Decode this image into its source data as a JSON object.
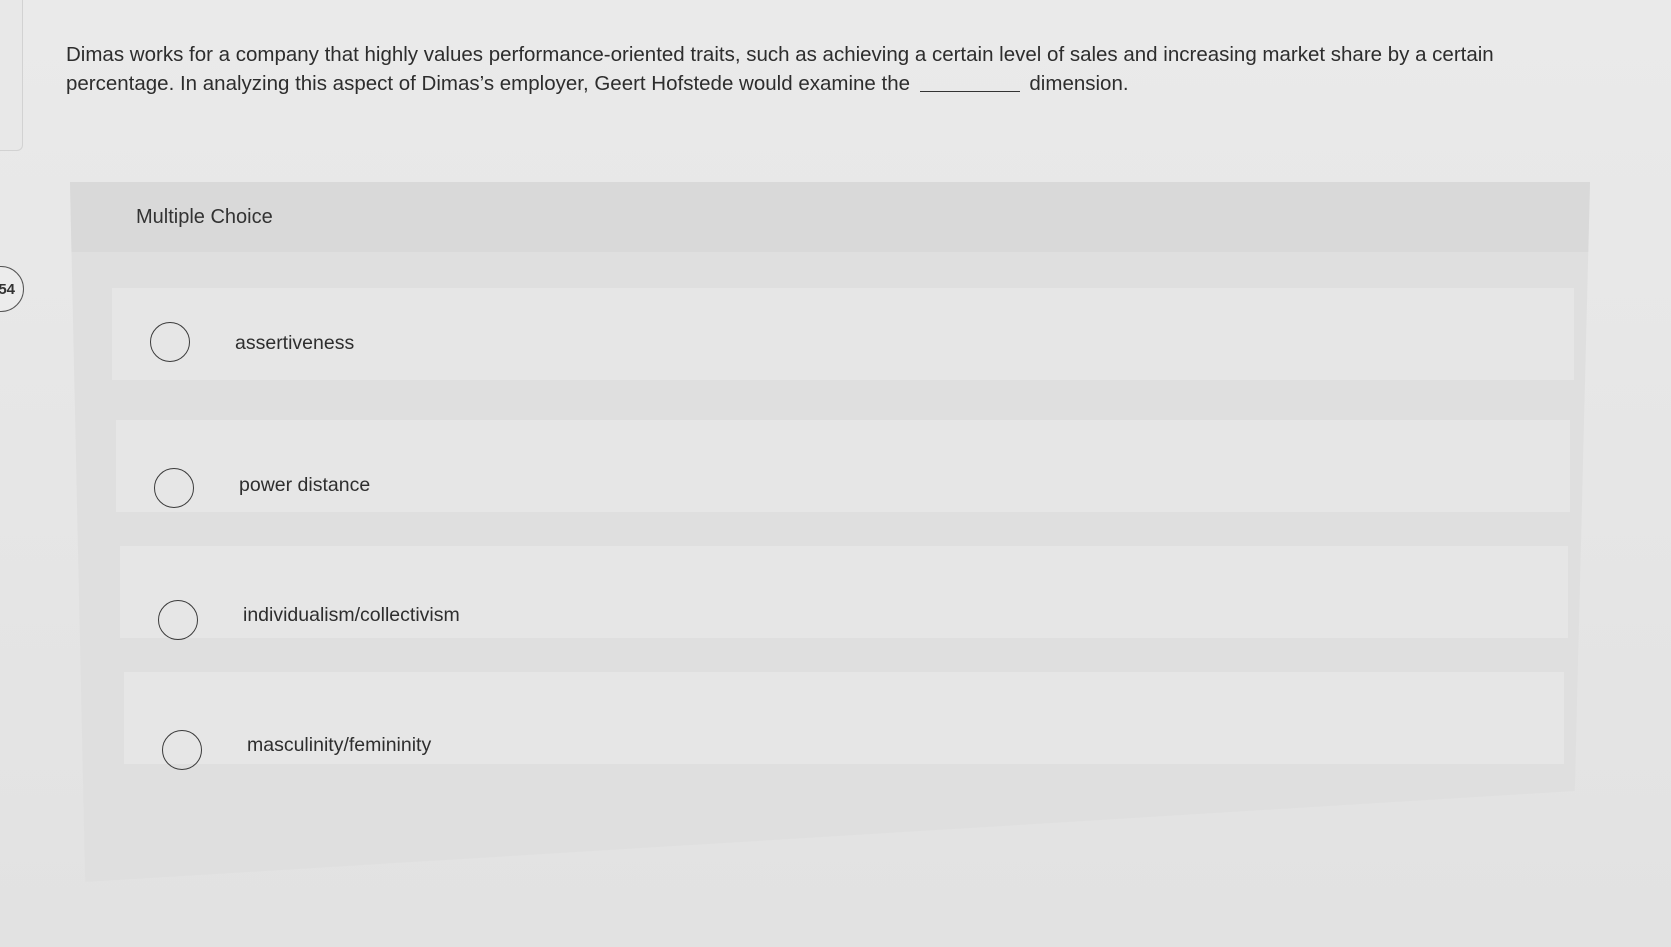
{
  "question": {
    "number": "54",
    "text_before_blank": "Dimas works for a company that highly values performance-oriented traits, such as achieving a certain level of sales and increasing market share by a certain percentage. In analyzing this aspect of Dimas’s employer, Geert Hofstede would examine the",
    "text_after_blank": "dimension."
  },
  "panel": {
    "label": "Multiple Choice"
  },
  "choices": [
    {
      "label": "assertiveness",
      "selected": false
    },
    {
      "label": "power distance",
      "selected": false
    },
    {
      "label": "individualism/collectivism",
      "selected": false
    },
    {
      "label": "masculinity/femininity",
      "selected": false
    }
  ]
}
